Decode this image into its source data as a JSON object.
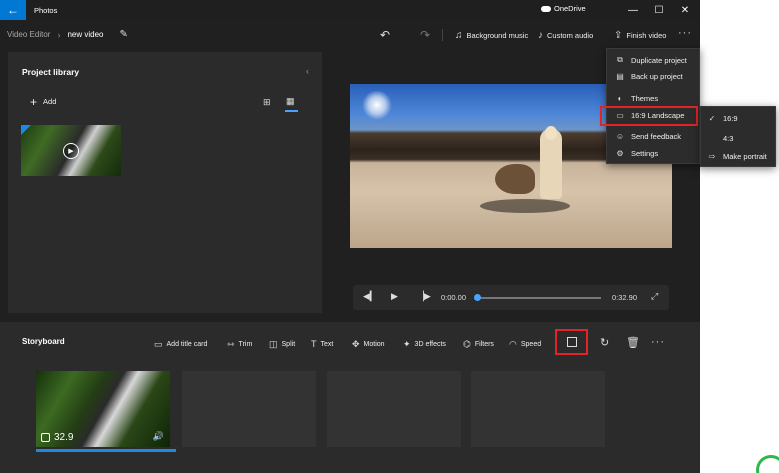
{
  "titlebar": {
    "app_title": "Photos",
    "onedrive": "OneDrive",
    "minimize": "—",
    "maximize": "☐",
    "close": "✕",
    "back": "←"
  },
  "toolbar": {
    "breadcrumb_root": "Video Editor",
    "breadcrumb_sep": "›",
    "project_name": "new video",
    "undo": "↶",
    "redo": "↷",
    "background_music": "Background music",
    "custom_audio": "Custom audio",
    "finish_video": "Finish video",
    "more": "···"
  },
  "library": {
    "title": "Project library",
    "add_label": "Add",
    "collapse": "‹"
  },
  "playback": {
    "current_time": "0:00.00",
    "total_time": "0:32.90",
    "progress": 0.0
  },
  "storyboard": {
    "title": "Storyboard",
    "tools": [
      {
        "label": "Add title card",
        "icon": "title-card-icon"
      },
      {
        "label": "Trim",
        "icon": "trim-icon"
      },
      {
        "label": "Split",
        "icon": "split-icon"
      },
      {
        "label": "Text",
        "icon": "text-icon"
      },
      {
        "label": "Motion",
        "icon": "motion-icon"
      },
      {
        "label": "3D effects",
        "icon": "3d-effects-icon"
      },
      {
        "label": "Filters",
        "icon": "filters-icon"
      },
      {
        "label": "Speed",
        "icon": "speed-icon"
      }
    ],
    "clip_duration": "32.9"
  },
  "more_menu": {
    "items": [
      {
        "label": "Duplicate project",
        "icon": "duplicate-icon"
      },
      {
        "label": "Back up project",
        "icon": "backup-icon"
      },
      {
        "label": "Themes",
        "icon": "themes-icon"
      },
      {
        "label": "16:9 Landscape",
        "icon": "aspect-ratio-icon"
      },
      {
        "label": "Send feedback",
        "icon": "feedback-icon"
      },
      {
        "label": "Settings",
        "icon": "settings-icon"
      }
    ]
  },
  "aspect_submenu": {
    "items": [
      {
        "label": "16:9",
        "checked": true
      },
      {
        "label": "4:3",
        "checked": false
      },
      {
        "label": "Make portrait",
        "checked": false
      }
    ]
  },
  "colors": {
    "accent": "#0078d4",
    "highlight_box": "#e0242a",
    "background": "#202020",
    "panel": "#2b2b2b"
  }
}
